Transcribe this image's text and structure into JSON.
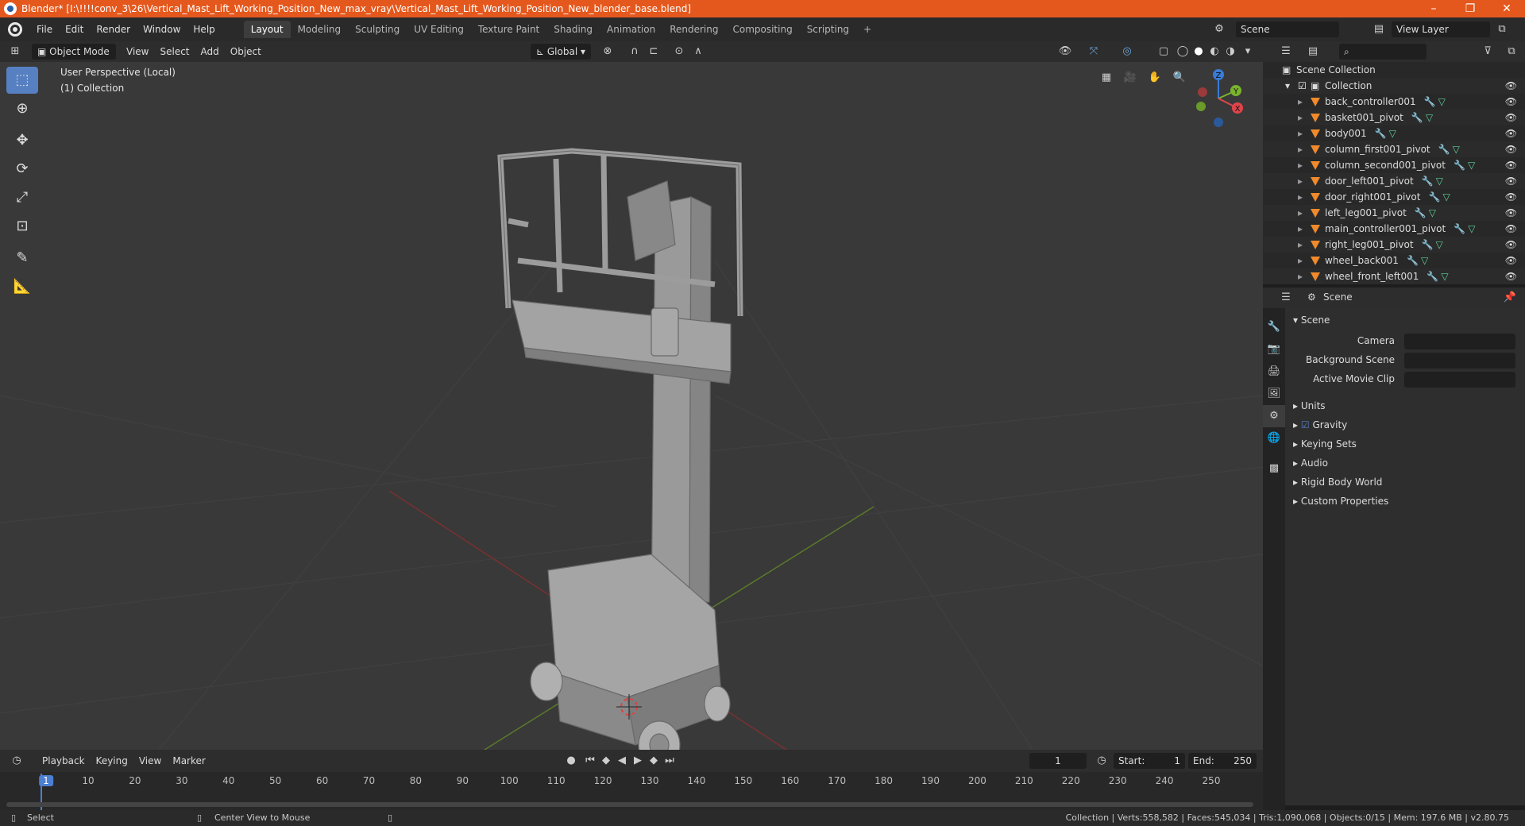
{
  "window": {
    "title": "Blender* [I:\\!!!!conv_3\\26\\Vertical_Mast_Lift_Working_Position_New_max_vray\\Vertical_Mast_Lift_Working_Position_New_blender_base.blend]",
    "minimize": "–",
    "restore": "❐",
    "close": "✕"
  },
  "menus": [
    "File",
    "Edit",
    "Render",
    "Window",
    "Help"
  ],
  "workspace_tabs": [
    "Layout",
    "Modeling",
    "Sculpting",
    "UV Editing",
    "Texture Paint",
    "Shading",
    "Animation",
    "Rendering",
    "Compositing",
    "Scripting",
    "+"
  ],
  "active_workspace": "Layout",
  "scene_name": "Scene",
  "view_layer": "View Layer",
  "viewport_header": {
    "mode": "Object Mode",
    "menus": [
      "View",
      "Select",
      "Add",
      "Object"
    ],
    "orientation": "Global"
  },
  "viewport": {
    "perspective_label": "User Perspective (Local)",
    "collection_label": "(1) Collection",
    "gizmo_axes": [
      "Z",
      "Y",
      "X"
    ]
  },
  "outliner": {
    "root": "Scene Collection",
    "collection": "Collection",
    "objects": [
      "back_controller001",
      "basket001_pivot",
      "body001",
      "column_first001_pivot",
      "column_second001_pivot",
      "door_left001_pivot",
      "door_right001_pivot",
      "left_leg001_pivot",
      "main_controller001_pivot",
      "right_leg001_pivot",
      "wheel_back001",
      "wheel_front_left001"
    ]
  },
  "properties": {
    "header": "Scene",
    "panel_title": "Scene",
    "fields": [
      {
        "label": "Camera"
      },
      {
        "label": "Background Scene"
      },
      {
        "label": "Active Movie Clip"
      }
    ],
    "sections": [
      "Units",
      "Gravity",
      "Keying Sets",
      "Audio",
      "Rigid Body World",
      "Custom Properties"
    ],
    "gravity_checked": true
  },
  "timeline": {
    "menus": [
      "Playback",
      "Keying",
      "View",
      "Marker"
    ],
    "current_frame": "1",
    "start_label": "Start:",
    "start": "1",
    "end_label": "End:",
    "end": "250",
    "ruler": [
      "1",
      "10",
      "20",
      "30",
      "40",
      "50",
      "60",
      "70",
      "80",
      "90",
      "100",
      "110",
      "120",
      "130",
      "140",
      "150",
      "160",
      "170",
      "180",
      "190",
      "200",
      "210",
      "220",
      "230",
      "240",
      "250"
    ]
  },
  "statusbar": {
    "left_action": "Select",
    "middle_action": "Center View to Mouse",
    "stats": "Collection | Verts:558,582 | Faces:545,034 | Tris:1,090,068 | Objects:0/15 | Mem: 197.6 MB | v2.80.75"
  },
  "colors": {
    "titlebar": "#e5581d",
    "active_tool": "#5680c2",
    "object_icon": "#f08a2a",
    "modifier_icon": "#6fa8dc",
    "mesh_icon": "#5fd39a"
  }
}
